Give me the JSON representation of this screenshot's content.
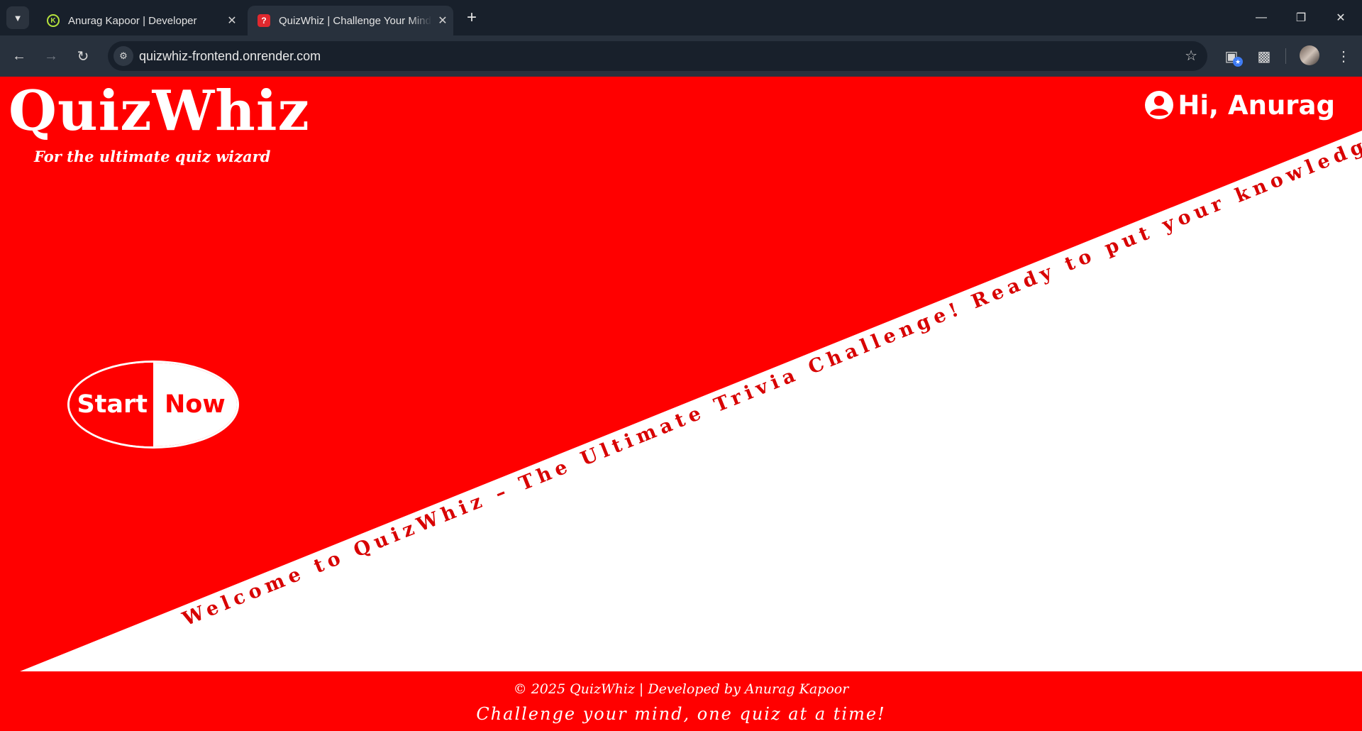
{
  "browser": {
    "tabs": [
      {
        "title": "Anurag Kapoor | Developer",
        "icon": "developer-logo-icon",
        "active": false
      },
      {
        "title": "QuizWhiz | Challenge Your Mind",
        "icon": "question-icon",
        "active": true
      }
    ],
    "url": "quizwhiz-frontend.onrender.com"
  },
  "page": {
    "logo": "QuizWhiz",
    "tagline": "For the ultimate quiz wizard",
    "greeting": "Hi, Anurag",
    "start_button": {
      "left": "Start",
      "right": "Now"
    },
    "diagonal_text": "Welcome to QuizWhiz – The Ultimate Trivia Challenge! Ready to put your knowledge to the test?",
    "footer": {
      "copyright": "© 2025 QuizWhiz | Developed by Anurag Kapoor",
      "slogan": "Challenge your mind, one quiz at a time!"
    }
  },
  "colors": {
    "brand_red": "#ff0000",
    "background_white": "#ffffff",
    "chrome_dark": "#18202b"
  }
}
